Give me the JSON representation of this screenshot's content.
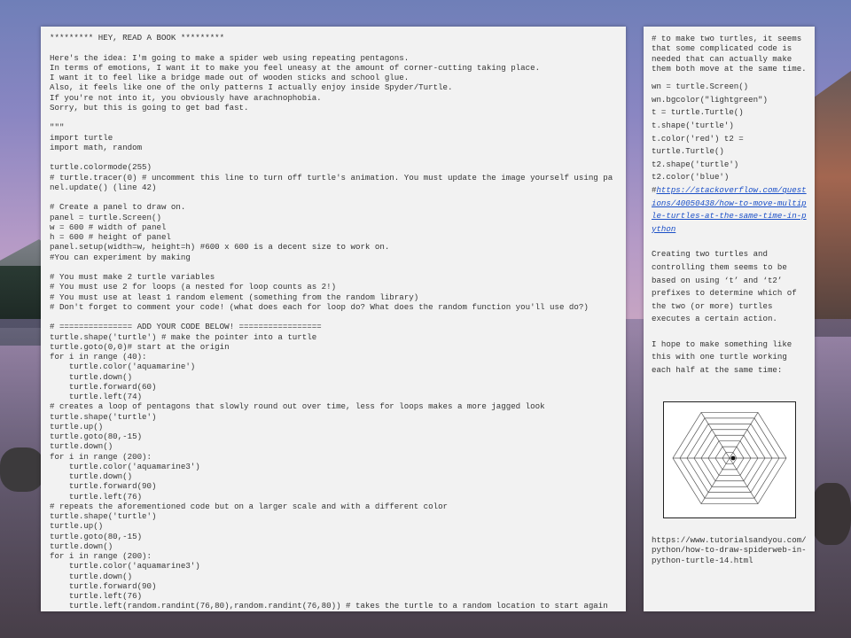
{
  "code_panel": {
    "lines": [
      "********* HEY, READ A BOOK *********",
      "",
      "Here's the idea: I'm going to make a spider web using repeating pentagons.",
      "In terms of emotions, I want it to make you feel uneasy at the amount of corner-cutting taking place.",
      "I want it to feel like a bridge made out of wooden sticks and school glue.",
      "Also, it feels like one of the only patterns I actually enjoy inside Spyder/Turtle.",
      "If you're not into it, you obviously have arachnophobia.",
      "Sorry, but this is going to get bad fast.",
      "",
      "\"\"\"",
      "import turtle",
      "import math, random",
      "",
      "turtle.colormode(255)",
      "# turtle.tracer(0) # uncomment this line to turn off turtle's animation. You must update the image yourself using panel.update() (line 42)",
      "",
      "# Create a panel to draw on.",
      "panel = turtle.Screen()",
      "w = 600 # width of panel",
      "h = 600 # height of panel",
      "panel.setup(width=w, height=h) #600 x 600 is a decent size to work on.",
      "#You can experiment by making",
      "",
      "# You must make 2 turtle variables",
      "# You must use 2 for loops (a nested for loop counts as 2!)",
      "# You must use at least 1 random element (something from the random library)",
      "# Don't forget to comment your code! (what does each for loop do? What does the random function you'll use do?)",
      "",
      "# =============== ADD YOUR CODE BELOW! =================",
      "turtle.shape('turtle') # make the pointer into a turtle",
      "turtle.goto(0,0)# start at the origin",
      "for i in range (40):",
      "    turtle.color('aquamarine')",
      "    turtle.down()",
      "    turtle.forward(60)",
      "    turtle.left(74)",
      "# creates a loop of pentagons that slowly round out over time, less for loops makes a more jagged look",
      "turtle.shape('turtle')",
      "turtle.up()",
      "turtle.goto(80,-15)",
      "turtle.down()",
      "for i in range (200):",
      "    turtle.color('aquamarine3')",
      "    turtle.down()",
      "    turtle.forward(90)",
      "    turtle.left(76)",
      "# repeats the aforementioned code but on a larger scale and with a different color",
      "turtle.shape('turtle')",
      "turtle.up()",
      "turtle.goto(80,-15)",
      "turtle.down()",
      "for i in range (200):",
      "    turtle.color('aquamarine3')",
      "    turtle.down()",
      "    turtle.forward(90)",
      "    turtle.left(76)",
      "    turtle.left(random.randint(76,80),random.randint(76,80)) # takes the turtle to a random location to start again"
    ]
  },
  "side_panel": {
    "note": "# to make two turtles, it seems that some complicated code is needed that can actually make them both move at the same time.",
    "code_lines": [
      "wn = turtle.Screen()",
      "wn.bgcolor(\"lightgreen\")",
      "t = turtle.Turtle()",
      "t.shape('turtle')",
      "t.color('red') t2 =",
      "turtle.Turtle()",
      "t2.shape('turtle')",
      "t2.color('blue')"
    ],
    "link_prefix": "#",
    "link_text": "https://stackoverflow.com/questions/40050438/how-to-move-multiple-turtles-at-the-same-time-in-python",
    "paragraph1": "Creating two turtles and controlling them seems to be based on using ‘t’ and ‘t2’ prefixes to determine which of the two (or more) turtles executes a certain action.",
    "paragraph2": "I hope to make something like this with one turtle working each half at the same time:",
    "source_url": "https://www.tutorialsandyou.com/python/how-to-draw-spiderweb-in-python-turtle-14.html"
  }
}
